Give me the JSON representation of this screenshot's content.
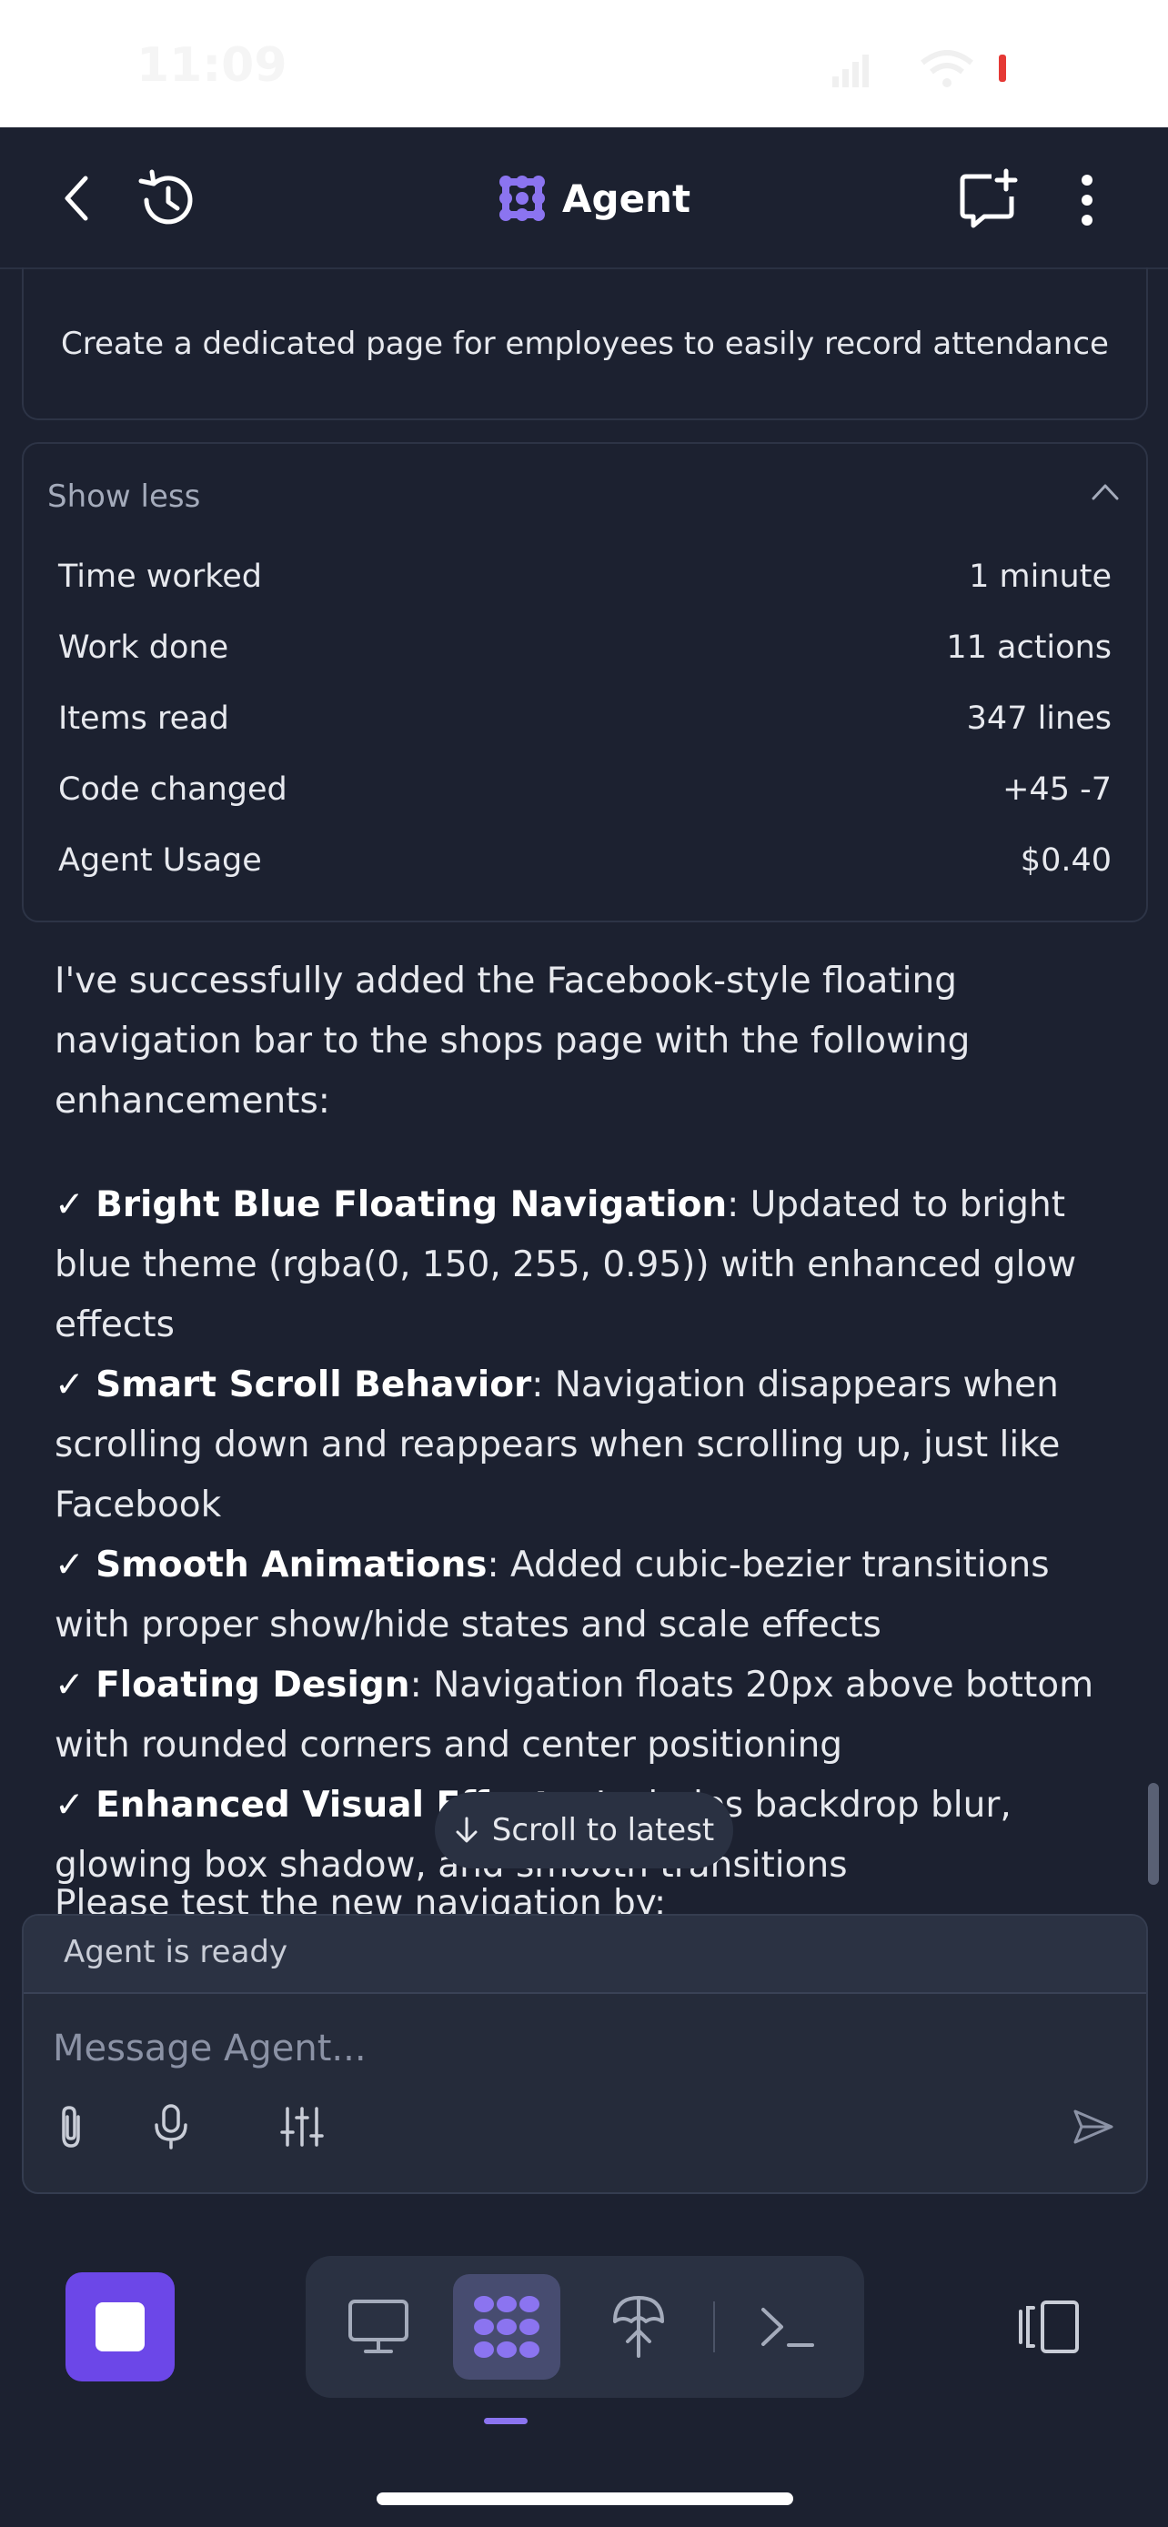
{
  "status_bar": {
    "time": "11:09"
  },
  "header": {
    "title": "Agent"
  },
  "prompt": {
    "text": "Create a dedicated page for employees to easily record attendance"
  },
  "stats": {
    "toggle_label": "Show less",
    "rows": [
      {
        "label": "Time worked",
        "value": "1 minute"
      },
      {
        "label": "Work done",
        "value": "11 actions"
      },
      {
        "label": "Items read",
        "value": "347 lines"
      },
      {
        "label": "Code changed",
        "value": "+45 -7"
      },
      {
        "label": "Agent Usage",
        "value": "$0.40"
      }
    ]
  },
  "message": {
    "intro": "I've successfully added the Facebook-style floating navigation bar to the shops page with the following enhancements:",
    "bullets": [
      {
        "check": "✓",
        "title": "Bright Blue Floating Navigation",
        "text": ": Updated to bright blue theme (rgba(0, 150, 255, 0.95)) with enhanced glow effects"
      },
      {
        "check": "✓",
        "title": "Smart Scroll Behavior",
        "text": ": Navigation disappears when scrolling down and reappears when scrolling up, just like Facebook"
      },
      {
        "check": "✓",
        "title": "Smooth Animations",
        "text": ": Added cubic-bezier transitions with proper show/hide states and scale effects"
      },
      {
        "check": "✓",
        "title": "Floating Design",
        "text": ": Navigation floats 20px above bottom with rounded corners and center positioning"
      },
      {
        "check": "✓",
        "title": "Enhanced Visual Effects",
        "text": ": Includes backdrop blur, glowing box shadow, and smooth transitions"
      }
    ],
    "next_line": "Please test the new navigation by:"
  },
  "scroll_button": {
    "label": "Scroll to latest"
  },
  "composer": {
    "status": "Agent is ready",
    "placeholder": "Message Agent..."
  },
  "colors": {
    "background": "#1c2130",
    "accent": "#6c47e8",
    "agent_logo": "#8b74f0"
  }
}
